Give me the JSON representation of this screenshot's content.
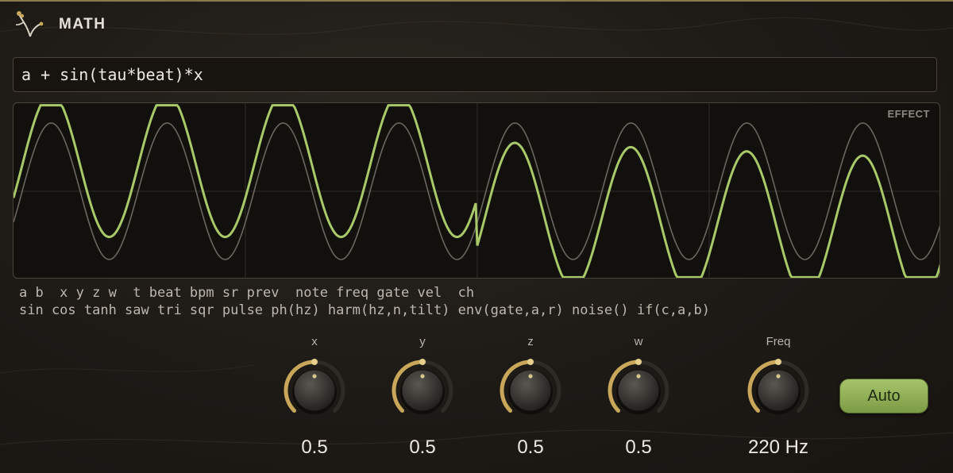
{
  "header": {
    "title": "MATH"
  },
  "expression": {
    "value": "a + sin(tau*beat)*x"
  },
  "scope": {
    "label": "EFFECT",
    "input_color": "#6a665f",
    "output_color": "#a9c969"
  },
  "reference": {
    "line1": "a b  x y z w  t beat bpm sr prev  note freq gate vel  ch",
    "line2": "sin cos tanh saw tri sqr pulse ph(hz) harm(hz,n,tilt) env(gate,a,r) noise() if(c,a,b)"
  },
  "knobs": [
    {
      "label": "x",
      "value": "0.5",
      "level": 0.5
    },
    {
      "label": "y",
      "value": "0.5",
      "level": 0.5
    },
    {
      "label": "z",
      "value": "0.5",
      "level": 0.5
    },
    {
      "label": "w",
      "value": "0.5",
      "level": 0.5
    },
    {
      "label": "Freq",
      "value": "220 Hz",
      "level": 0.5
    }
  ],
  "auto_button": {
    "label": "Auto"
  },
  "colors": {
    "accent": "#c9a75a",
    "knob_track": "#2e2a24",
    "button": "#98b85a"
  },
  "icons": {
    "logo": "branch-logo-icon"
  }
}
